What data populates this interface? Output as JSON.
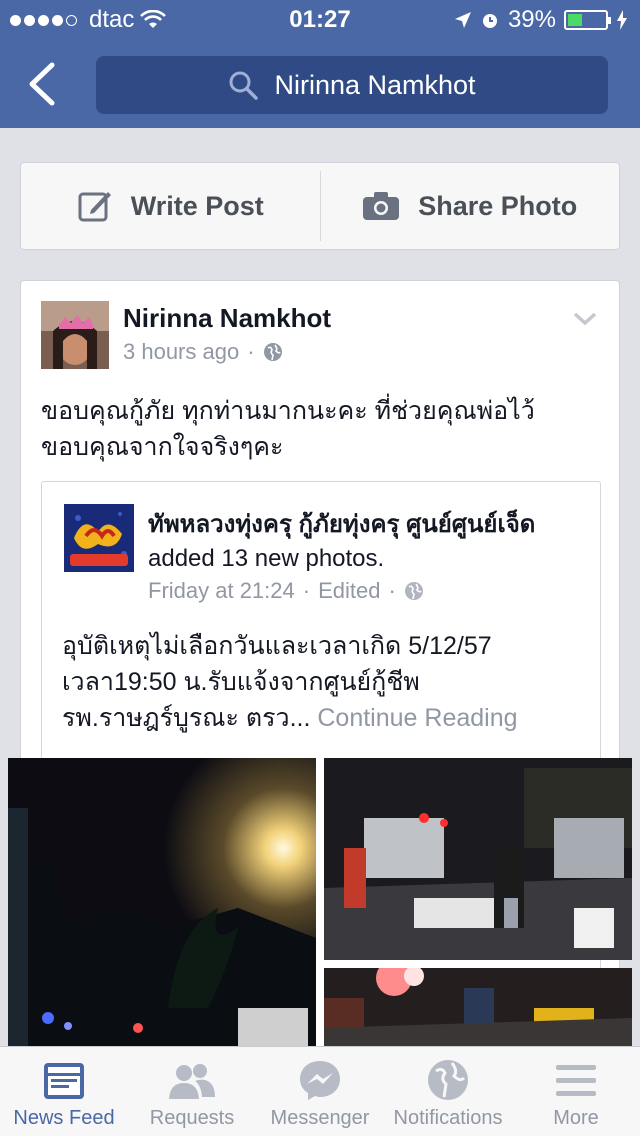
{
  "status_bar": {
    "carrier": "dtac",
    "signal_bars": 4,
    "time": "01:27",
    "battery_percent": "39%",
    "battery_level": 0.39
  },
  "nav": {
    "search_text": "Nirinna Namkhot"
  },
  "composer": {
    "write_post_label": "Write Post",
    "share_photo_label": "Share Photo"
  },
  "post": {
    "author": "Nirinna Namkhot",
    "time": "3 hours ago",
    "separator": "·",
    "text": "ขอบคุณกู้ภัย ทุกท่านมากนะคะ ที่ช่วยคุณพ่อไว้ ขอบคุณจากใจจริงๆคะ",
    "shared": {
      "page_name": "ทัพหลวงทุ่งครุ กู้ภัยทุ่งครุ ศูนย์ศูนย์เจ็ด",
      "action": "added 13 new photos.",
      "time": "Friday at 21:24",
      "edited": "Edited",
      "body": "อุบัติเหตุไม่เลือกวันและเวลาเกิด 5/12/57 เวลา19:50 น.รับแจ้งจากศูนย์กู้ชีพ รพ.ราษฎร์บูรณะ ตรว...",
      "continue_reading": "Continue Reading"
    }
  },
  "tabs": [
    {
      "label": "News Feed",
      "icon": "news-feed-icon",
      "active": true
    },
    {
      "label": "Requests",
      "icon": "friend-requests-icon",
      "active": false
    },
    {
      "label": "Messenger",
      "icon": "messenger-icon",
      "active": false
    },
    {
      "label": "Notifications",
      "icon": "globe-icon",
      "active": false
    },
    {
      "label": "More",
      "icon": "menu-icon",
      "active": false
    }
  ],
  "colors": {
    "brand": "#4a68a6",
    "search_bg": "#2f4a85",
    "page_bg": "#dfe1e6",
    "battery_fill": "#4cd964"
  }
}
